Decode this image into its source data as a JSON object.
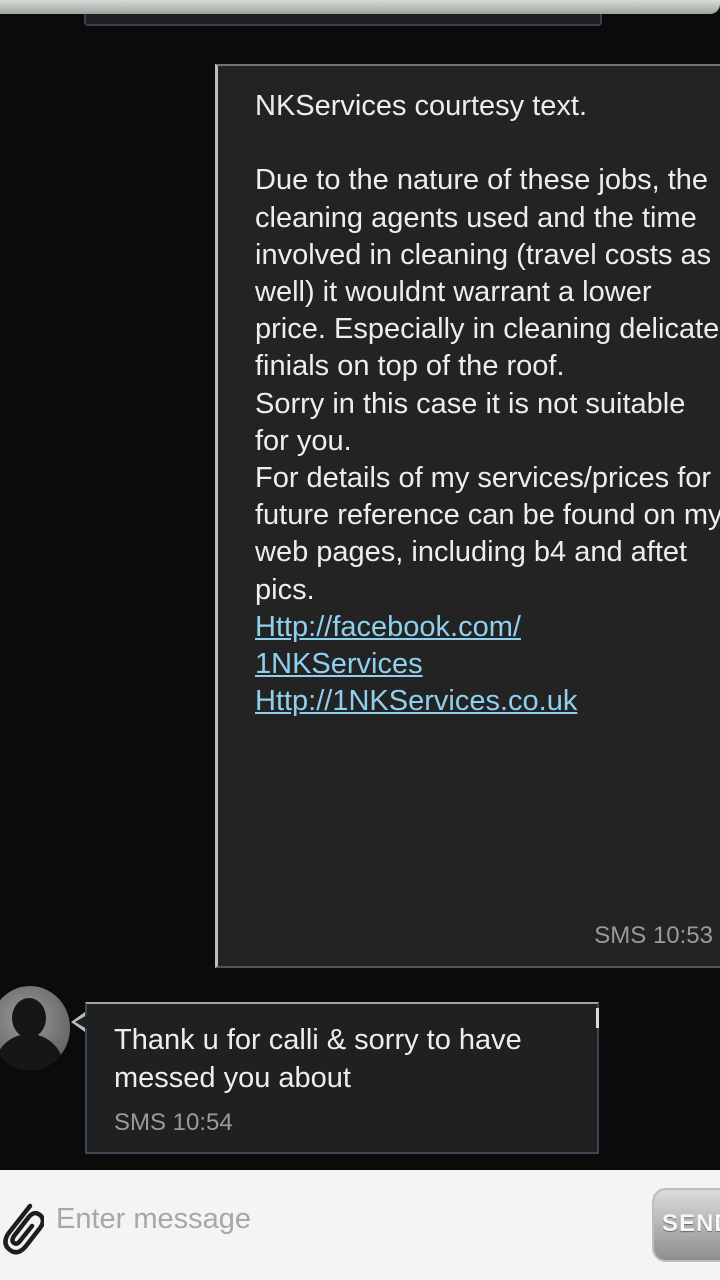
{
  "conversation": {
    "messages": [
      {
        "direction": "outgoing",
        "text": "NKServices courtesy text.\n\nDue to the nature of these jobs, the cleaning agents used and the time involved in cleaning (travel costs as well) it wouldnt warrant a lower price. Especially in cleaning delicate finials on top of the roof.\nSorry in this case it is not suitable for you.\nFor details of my services/prices for future reference can be found on my web pages, including b4 and aftet pics.",
        "links": [
          "Http://facebook.com/\n1NKServices",
          "Http://1NKServices.co.uk"
        ],
        "meta": "SMS 10:53"
      },
      {
        "direction": "incoming",
        "text": "Thank u for calli & sorry to have messed you about",
        "meta": "SMS 10:54"
      }
    ]
  },
  "composer": {
    "placeholder": "Enter message",
    "send_label": "SEND"
  },
  "icons": {
    "attach": "paperclip-icon",
    "avatar": "person-silhouette-icon"
  }
}
